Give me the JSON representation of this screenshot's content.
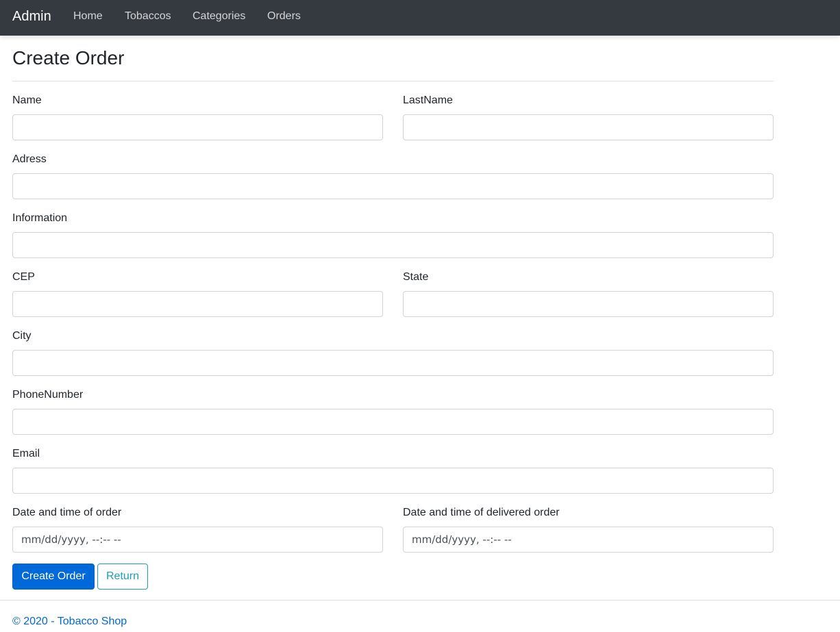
{
  "navbar": {
    "brand": "Admin",
    "items": [
      {
        "label": "Home"
      },
      {
        "label": "Tobaccos"
      },
      {
        "label": "Categories"
      },
      {
        "label": "Orders"
      }
    ]
  },
  "page": {
    "title": "Create Order"
  },
  "form": {
    "name": {
      "label": "Name",
      "value": ""
    },
    "last_name": {
      "label": "LastName",
      "value": ""
    },
    "address": {
      "label": "Adress",
      "value": ""
    },
    "information": {
      "label": "Information",
      "value": ""
    },
    "cep": {
      "label": "CEP",
      "value": ""
    },
    "state": {
      "label": "State",
      "value": ""
    },
    "city": {
      "label": "City",
      "value": ""
    },
    "phone_number": {
      "label": "PhoneNumber",
      "value": ""
    },
    "email": {
      "label": "Email",
      "value": ""
    },
    "order_datetime": {
      "label": "Date and time of order",
      "display": "mm/dd/yyyy, --:-- --"
    },
    "delivered_datetime": {
      "label": "Date and time of delivered order",
      "display": "mm/dd/yyyy, --:-- --"
    },
    "submit_label": "Create Order",
    "return_label": "Return"
  },
  "footer": {
    "copyright": "© 2020 - ",
    "link": "Tobacco Shop"
  },
  "colors": {
    "navbar_bg": "#343a40",
    "primary": "#0069d9",
    "outline": "#17a2b8"
  }
}
